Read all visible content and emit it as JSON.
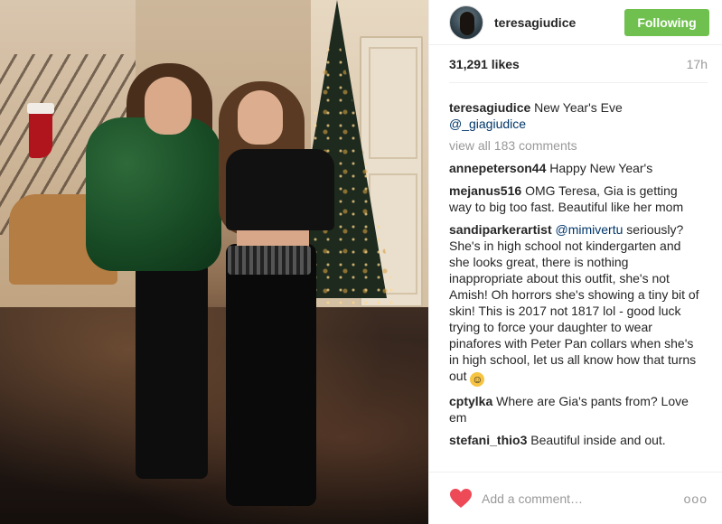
{
  "post": {
    "photo_alt": "Two women posing in front of a Christmas tree"
  },
  "header": {
    "username": "teresagiudice",
    "follow_label": "Following",
    "follow_color": "#70c050"
  },
  "meta": {
    "likes": "31,291 likes",
    "time": "17h"
  },
  "caption": {
    "author": "teresagiudice",
    "text": "New Year's Eve",
    "mention": "@_giagiudice"
  },
  "view_all": "view all 183 comments",
  "comments": [
    {
      "author": "annepeterson44",
      "text": "Happy New Year's"
    },
    {
      "author": "mejanus516",
      "text": "OMG Teresa, Gia is getting way to big too fast. Beautiful like her mom"
    },
    {
      "author": "sandiparkerartist",
      "mention": "@mimivertu",
      "text": "seriously? She's in high school not kindergarten and she looks great, there is nothing inappropriate about this outfit, she's not Amish! Oh horrors she's showing a tiny bit of skin! This is 2017 not 1817 lol - good luck trying to force your daughter to wear pinafores with Peter Pan collars when she's in high school, let us all know how that turns out"
    },
    {
      "author": "cptylka",
      "text": "Where are Gia's pants from? Love em"
    },
    {
      "author": "stefani_thio3",
      "text": "Beautiful inside and out."
    }
  ],
  "add_comment": {
    "placeholder": "Add a comment…",
    "more": "ooo",
    "heart_color": "#ed4956"
  }
}
